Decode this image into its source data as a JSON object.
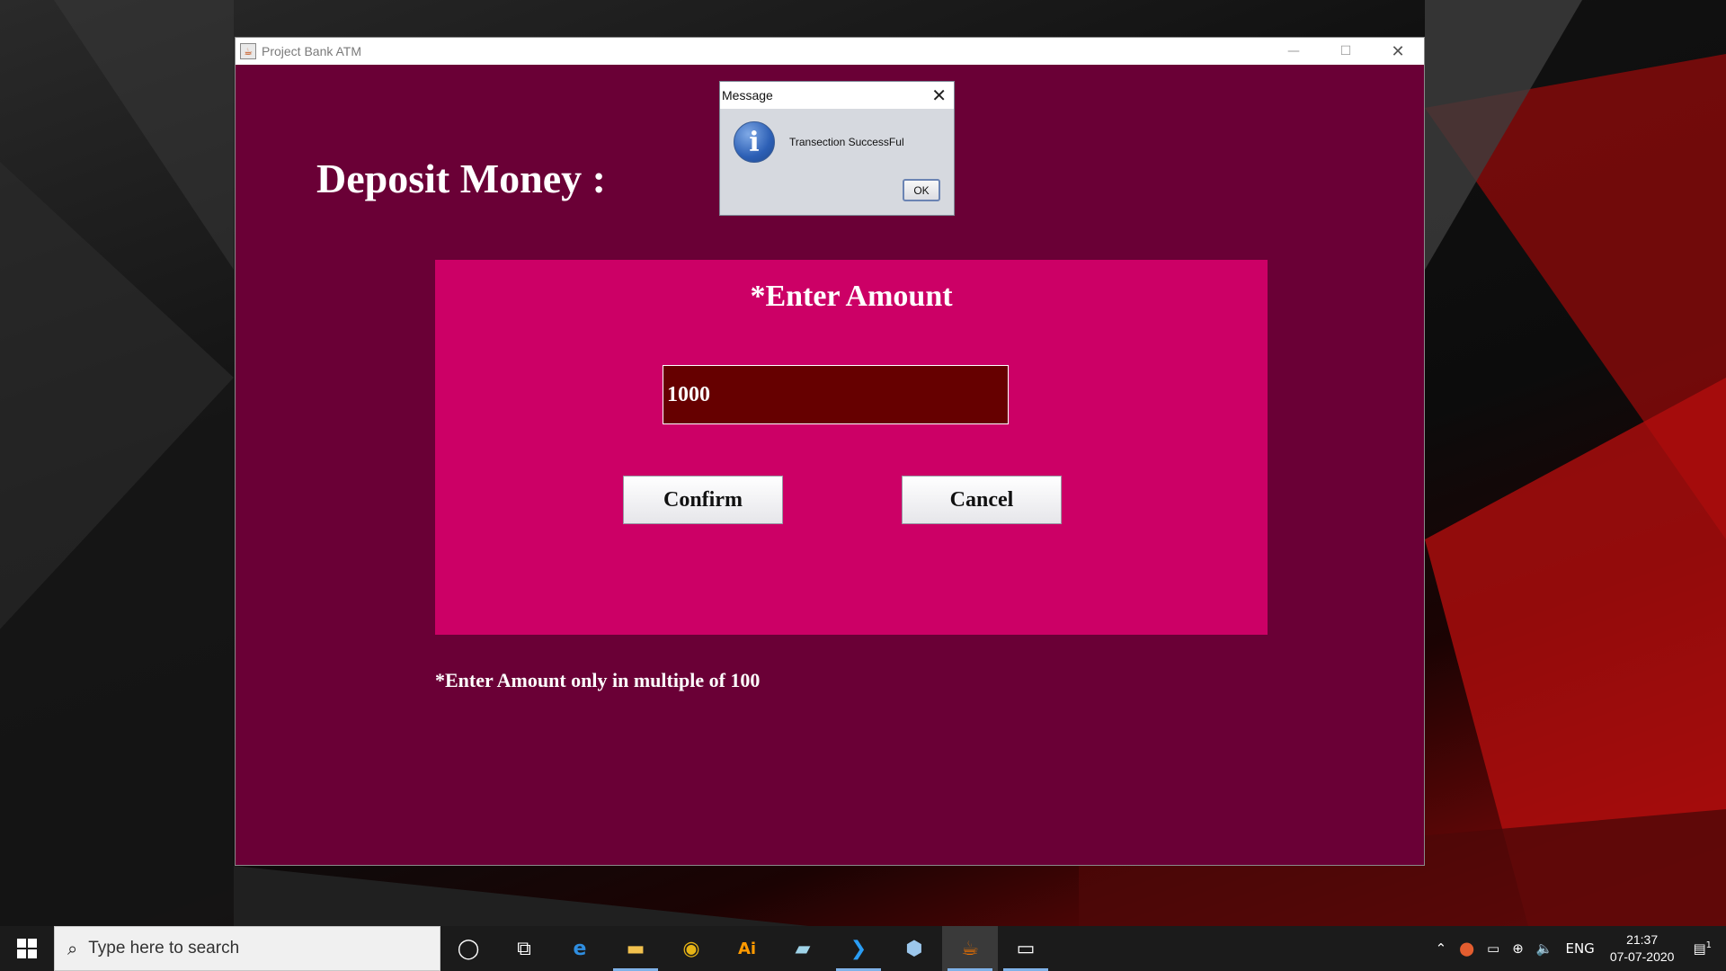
{
  "window": {
    "title": "Project Bank ATM",
    "heading": "Deposit Money :",
    "panel_title": "*Enter Amount",
    "amount_value": "1000",
    "confirm_label": "Confirm",
    "cancel_label": "Cancel",
    "hint": "*Enter Amount only in multiple of 100",
    "controls": {
      "minimize": "—",
      "maximize": "☐",
      "close": "✕"
    }
  },
  "dialog": {
    "title": "Message",
    "message": "Transection SuccessFul",
    "ok_label": "OK",
    "close": "✕",
    "icon_glyph": "i"
  },
  "taskbar": {
    "search_placeholder": "Type here to search",
    "language": "ENG",
    "time": "21:37",
    "date": "07-07-2020",
    "notification_count": "1",
    "apps": [
      {
        "name": "cortana-icon",
        "glyph": "◯"
      },
      {
        "name": "task-view-icon",
        "glyph": "⧉"
      },
      {
        "name": "edge-icon",
        "glyph": "e"
      },
      {
        "name": "file-explorer-icon",
        "glyph": "▬"
      },
      {
        "name": "chrome-icon",
        "glyph": "◉"
      },
      {
        "name": "illustrator-icon",
        "glyph": "Ai"
      },
      {
        "name": "notepad-icon",
        "glyph": "▰"
      },
      {
        "name": "vscode-icon",
        "glyph": "❯"
      },
      {
        "name": "virtualbox-icon",
        "glyph": "⬢"
      },
      {
        "name": "java-icon",
        "glyph": "☕"
      },
      {
        "name": "terminal-icon",
        "glyph": "▭"
      }
    ]
  },
  "colors": {
    "window_bg": "#6a0036",
    "panel_bg": "#cc0066",
    "input_bg": "#660000",
    "taskbar_bg": "#1b1b1b"
  }
}
